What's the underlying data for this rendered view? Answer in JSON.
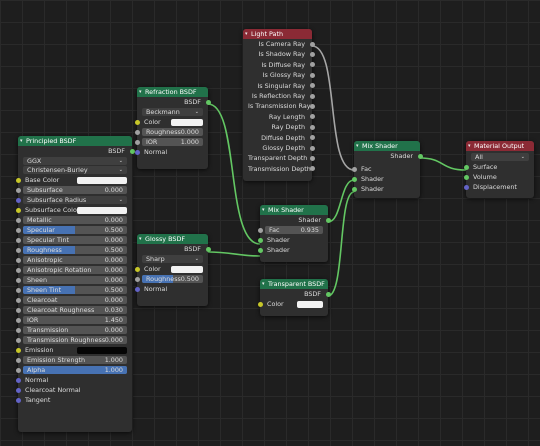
{
  "colors": {
    "node_header_shader": "#21724a",
    "node_header_output": "#8b2a35",
    "socket_shader": "#63c763",
    "socket_color": "#c7c729",
    "socket_value": "#a1a1a1",
    "socket_vector": "#6363c7",
    "field_fill": "#4772b3"
  },
  "principled": {
    "title": "Principled BSDF",
    "out": "BSDF",
    "distribution": "GGX",
    "subsurface_method": "Christensen-Burley",
    "inputs": [
      {
        "label": "Base Color",
        "type": "color"
      },
      {
        "label": "Subsurface",
        "value": "0.000"
      },
      {
        "label": "Subsurface Radius",
        "type": "dropdown"
      },
      {
        "label": "Subsurface Color",
        "type": "color"
      },
      {
        "label": "Metallic",
        "value": "0.000"
      },
      {
        "label": "Specular",
        "value": "0.500",
        "fill": 0.5
      },
      {
        "label": "Specular Tint",
        "value": "0.000"
      },
      {
        "label": "Roughness",
        "value": "0.500",
        "fill": 0.5
      },
      {
        "label": "Anisotropic",
        "value": "0.000"
      },
      {
        "label": "Anisotropic Rotation",
        "value": "0.000"
      },
      {
        "label": "Sheen",
        "value": "0.000"
      },
      {
        "label": "Sheen Tint",
        "value": "0.500",
        "fill": 0.5
      },
      {
        "label": "Clearcoat",
        "value": "0.000"
      },
      {
        "label": "Clearcoat Roughness",
        "value": "0.030"
      },
      {
        "label": "IOR",
        "value": "1.450"
      },
      {
        "label": "Transmission",
        "value": "0.000"
      },
      {
        "label": "Transmission Roughness",
        "value": "0.000"
      },
      {
        "label": "Emission",
        "type": "color_black"
      },
      {
        "label": "Emission Strength",
        "value": "1.000"
      },
      {
        "label": "Alpha",
        "value": "1.000",
        "fill": 1.0
      },
      {
        "label": "Normal",
        "type": "plain"
      },
      {
        "label": "Clearcoat Normal",
        "type": "plain"
      },
      {
        "label": "Tangent",
        "type": "plain"
      }
    ]
  },
  "refraction": {
    "title": "Refraction BSDF",
    "out": "BSDF",
    "distribution": "Beckmann",
    "color": "Color",
    "roughness_label": "Roughness",
    "roughness": "0.000",
    "ior_label": "IOR",
    "ior": "1.000",
    "normal": "Normal"
  },
  "glossy": {
    "title": "Glossy BSDF",
    "out": "BSDF",
    "distribution": "Sharp",
    "color": "Color",
    "roughness_label": "Roughness",
    "roughness": "0.500",
    "normal": "Normal"
  },
  "light_path": {
    "title": "Light Path",
    "outputs": [
      "Is Camera Ray",
      "Is Shadow Ray",
      "Is Diffuse Ray",
      "Is Glossy Ray",
      "Is Singular Ray",
      "Is Reflection Ray",
      "Is Transmission Ray",
      "Ray Length",
      "Ray Depth",
      "Diffuse Depth",
      "Glossy Depth",
      "Transparent Depth",
      "Transmission Depth"
    ]
  },
  "mix1": {
    "title": "Mix Shader",
    "out": "Shader",
    "fac_label": "Fac",
    "fac": "0.935",
    "in1": "Shader",
    "in2": "Shader"
  },
  "mix2": {
    "title": "Mix Shader",
    "out": "Shader",
    "fac": "Fac",
    "in1": "Shader",
    "in2": "Shader"
  },
  "transparent": {
    "title": "Transparent BSDF",
    "out": "BSDF",
    "color": "Color"
  },
  "output": {
    "title": "Material Output",
    "target": "All",
    "inputs": [
      "Surface",
      "Volume",
      "Displacement"
    ]
  }
}
